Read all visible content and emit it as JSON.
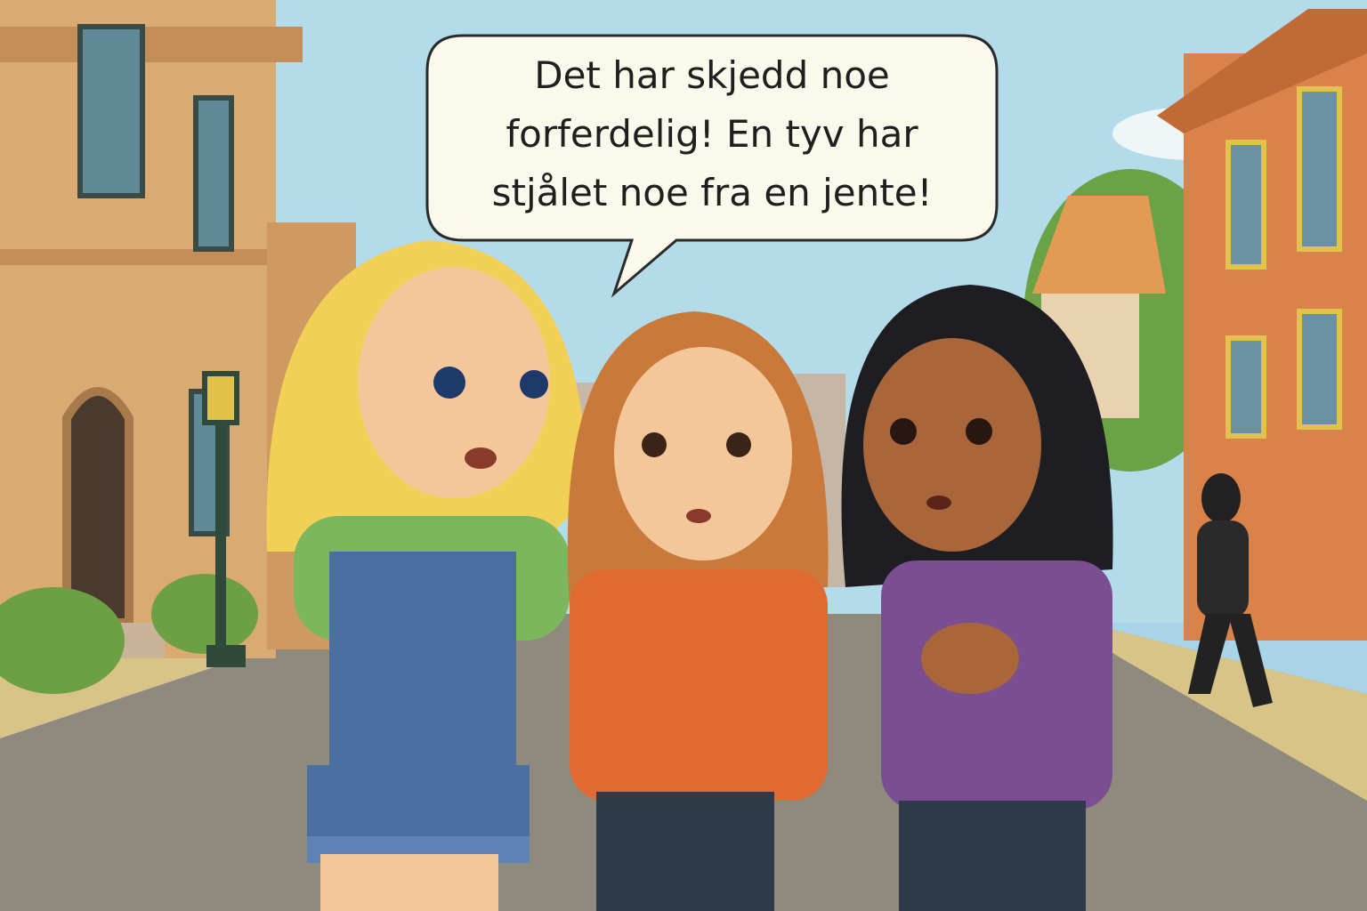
{
  "speech_bubble": {
    "lines": [
      "Det har skjedd noe",
      "forferdelig! En tyv har",
      "stjålet noe fra en jente!"
    ]
  },
  "colors": {
    "sky": "#a9d3e6",
    "building_left": "#d9aa72",
    "building_right": "#d9824a",
    "road": "#8f8a7e",
    "sidewalk": "#d8c486",
    "grass": "#7fae4a",
    "girl_left_hair": "#f2cf55",
    "girl_left_shirt": "#7cb65d",
    "girl_left_overalls": "#4a6fa0",
    "girl_middle_hair": "#c97a3a",
    "girl_middle_shirt": "#e06a32",
    "girl_right_hair": "#1e1e22",
    "girl_right_shirt": "#7b4e92",
    "thief": "#222222"
  }
}
